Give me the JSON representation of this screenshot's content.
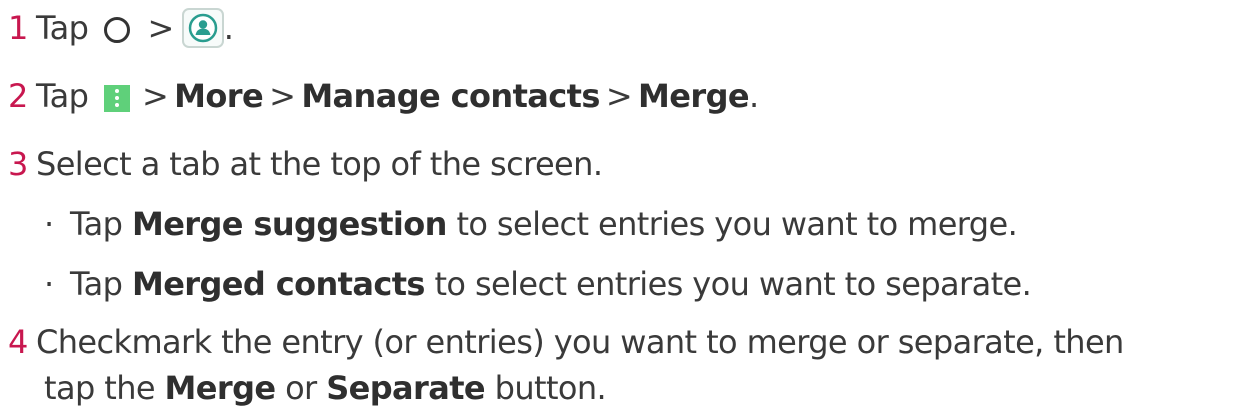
{
  "steps": [
    {
      "number": "1",
      "tap": "Tap",
      "sep": ">",
      "tail": "."
    },
    {
      "number": "2",
      "tap": "Tap",
      "sep1": ">",
      "more": "More",
      "sep2": ">",
      "manage": "Manage contacts",
      "sep3": ">",
      "merge": "Merge",
      "tail": "."
    },
    {
      "number": "3",
      "text": "Select a tab at the top of the screen."
    },
    {
      "number": "4",
      "line1": "Checkmark the entry (or entries) you want to merge or separate, then",
      "line2_pre": "tap the",
      "merge": "Merge",
      "or": "or",
      "separate": "Separate",
      "line2_post": "button."
    }
  ],
  "bullets": [
    {
      "mark": "·",
      "pre": "Tap",
      "bold": "Merge suggestion",
      "post": "to select entries you want to merge."
    },
    {
      "mark": "·",
      "pre": "Tap",
      "bold": "Merged contacts",
      "post": "to select entries you want to separate."
    }
  ],
  "icons": {
    "home": "home-circle-icon",
    "contacts": "contacts-app-icon",
    "menu": "more-options-icon"
  },
  "colors": {
    "step_number": "#c8174f",
    "text": "#3a3a3a",
    "menu_icon_bg": "#5fd07a",
    "contacts_icon": "#2a9d8f"
  }
}
